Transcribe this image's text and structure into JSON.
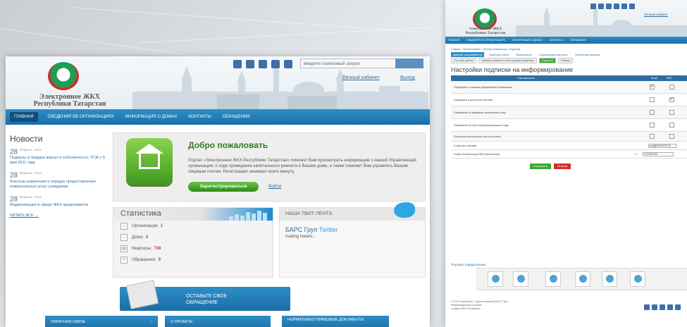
{
  "left": {
    "site_title_line1": "Электронное ЖКХ",
    "site_title_line2": "Республики Татарстан",
    "search_placeholder": "введите поисковый запрос",
    "search_button": "",
    "cabinet_link": "Личный кабинет",
    "exit_link": "Выход",
    "nav": [
      "ГЛАВНАЯ",
      "СВЕДЕНИЯ ОБ ОРГАНИЗАЦИЯХ",
      "ИНФОРМАЦИЯ О ДОМАХ",
      "КОНТАКТЫ",
      "ОБРАЩЕНИЯ"
    ],
    "news": {
      "heading": "Новости",
      "items": [
        {
          "day": "28",
          "month": "Февраль",
          "year": "2012",
          "text": "Подвалы и чердаки вернут в собственность ТСЖ с 5 мая 2011 года"
        },
        {
          "day": "28",
          "month": "Февраль",
          "year": "2012",
          "text": "Внесены изменения в порядок предоставления коммунальных услуг гражданам"
        },
        {
          "day": "28",
          "month": "Февраль",
          "year": "2012",
          "text": "Модернизация в сфере ЖКХ продолжается"
        }
      ],
      "more": "ЧИТАТЬ ВСЕ →"
    },
    "welcome": {
      "title": "Добро пожаловать",
      "text": "Портал «Электронное ЖКХ Республики Татарстан» поможет Вам просмотреть информацию о вашей Управляющей организации, о ходе проведения капитального ремонта в Вашем доме, а также поможет Вам управлять Вашим лицевым счетом. Регистрация занимает всего минуту.",
      "register": "Зарегистрироваться",
      "login": "Войти"
    },
    "stats": {
      "title": "Статистика",
      "rows": [
        {
          "label": "Организации:",
          "value": "1"
        },
        {
          "label": "Дома:",
          "value": "4"
        },
        {
          "label": "Квартиры:",
          "value": "736"
        },
        {
          "label": "Обращения:",
          "value": "0"
        }
      ]
    },
    "twitter": {
      "heading": "НАША ТВИТ-ЛЕНТА",
      "name": "БАРС Груп",
      "name_suffix": "Twitter",
      "loading": "loading tweets..."
    },
    "appeal": {
      "line1": "ОСТАВЬТЕ СВОЕ",
      "line2": "ОБРАЩЕНИЕ"
    },
    "bottom": [
      "ОБРАТНАЯ СВЯЗЬ",
      "О ПРОЕКТЕ",
      "НОРМАТИВНО ПРАВОВЫЕ ДОКУМЕНТЫ"
    ]
  },
  "right": {
    "site_title_line1": "Электронное ЖКХ",
    "site_title_line2": "Республики Татарстан",
    "nav": [
      "ГЛАВНАЯ",
      "СВЕДЕНИЯ ОБ ОРГАНИЗАЦИЯХ",
      "ИНФОРМАЦИЯ О ДОМАХ",
      "КОНТАКТЫ",
      "ОБРАЩЕНИЯ"
    ],
    "cabinet_link": "Личный кабинет",
    "breadcrumb": "Главная › Личный кабинет › Личная информация › Подписка",
    "tabs": [
      "Данные пользователя",
      "Приборы учета",
      "Начисления",
      "Социальные выплаты",
      "Претензия/ жалоба"
    ],
    "subtabs": [
      "Счетчики данных",
      "Приборы (лицевого счета и данных) квартиры",
      "Подписка",
      "Помощь"
    ],
    "page_title": "Настройки подписки на информирование",
    "table_headers": [
      "Тема рассылки",
      "Email",
      "SMS"
    ],
    "rows": [
      {
        "label": "Обращения к главному управляющей организации",
        "email": true,
        "sms": false
      },
      {
        "label": "Обращения в доступные системы",
        "email": false,
        "sms": true
      },
      {
        "label": "Обращения об аварийных отключениях услуг",
        "email": false,
        "sms": false
      },
      {
        "label": "Обращения об учете приборов квартиры в ходе",
        "email": false,
        "sms": false
      },
      {
        "label": "Получения технического счета на оплату",
        "email": false,
        "sms": false
      }
    ],
    "email_label": "E-mail для отправки",
    "email_value": "mail@SERVER.RU",
    "phone_label": "Номер телефона для SMS (мобильный)",
    "phone_prefix": "+7",
    "phone_value": "1234567890",
    "save": "Сохранить",
    "cancel": "Отмена",
    "portals": "Порталы города Казань",
    "footer_line1": "© 2012 Разработка - Группа компаний БАРС Груп",
    "footer_line2": "Информационная система",
    "footer_line3": "в сфере ЖКХ Республики"
  }
}
